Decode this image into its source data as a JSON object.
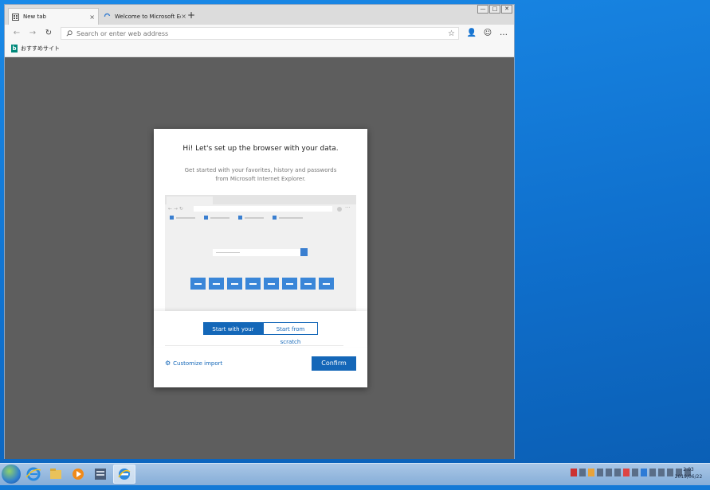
{
  "browser": {
    "window_controls": [
      "—",
      "□",
      "✕"
    ],
    "tabs": [
      {
        "label": "New tab",
        "icon": "newtab-icon",
        "active": true,
        "close": "×"
      },
      {
        "label": "Welcome to Microsoft Edge Can",
        "icon": "loading-spinner-icon",
        "active": false,
        "close": "×"
      }
    ],
    "new_tab_button": "+",
    "toolbar": {
      "back": "←",
      "forward": "→",
      "refresh": "↻",
      "address_placeholder": "Search or enter web address",
      "favorite_star": "☆",
      "profile": "👤",
      "feedback": "☺",
      "more": "…"
    },
    "favorites_bar": [
      {
        "label": "おすすめサイト",
        "icon": "bing-icon",
        "icon_text": "b"
      }
    ]
  },
  "dialog": {
    "title": "Hi! Let's set up the browser with your data.",
    "subtitle": "Get started with your favorites, history and passwords from Microsoft Internet Explorer.",
    "segments": {
      "selected": "Start with your data",
      "other": "Start from scratch"
    },
    "customize_label": "Customize import",
    "confirm_label": "Confirm"
  },
  "taskbar": {
    "items": [
      "start-button",
      "ie-icon",
      "explorer-icon",
      "media-player-icon",
      "app-icon",
      "edge-icon"
    ],
    "clock": {
      "time": "2:03",
      "date": "2019/06/22"
    }
  },
  "colors": {
    "accent": "#1467b8",
    "content_bg": "#5e5e5e",
    "desktop": "#1279d6"
  }
}
